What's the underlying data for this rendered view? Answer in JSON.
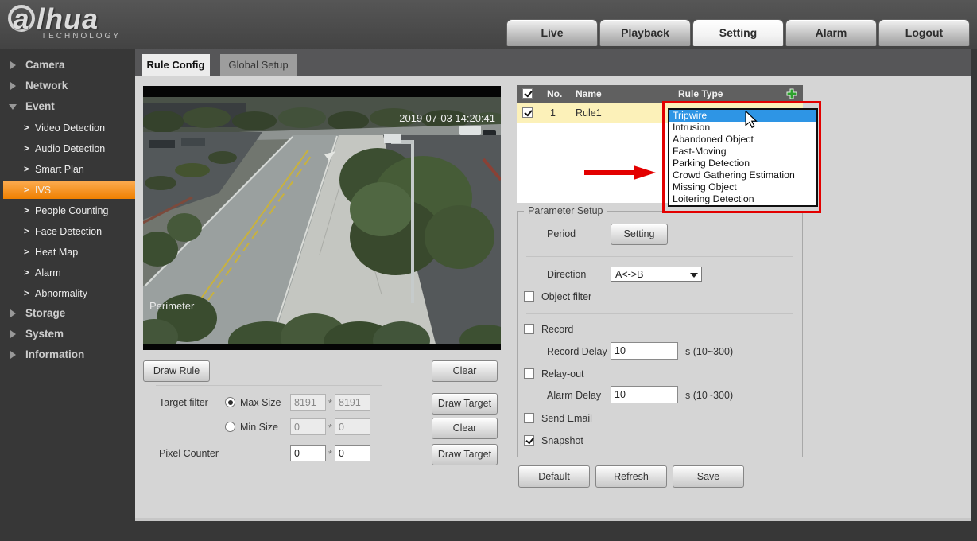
{
  "header": {
    "logo_text": "a",
    "logo_text_rest": "lhua",
    "logo_subtext": "TECHNOLOGY",
    "nav": [
      {
        "label": "Live"
      },
      {
        "label": "Playback"
      },
      {
        "label": "Setting"
      },
      {
        "label": "Alarm"
      },
      {
        "label": "Logout"
      }
    ],
    "active_nav": "Setting"
  },
  "sidebar": {
    "chevron_glyph": ">",
    "items": [
      {
        "label": "Camera"
      },
      {
        "label": "Network"
      },
      {
        "label": "Event"
      },
      {
        "label": "Storage"
      },
      {
        "label": "System"
      },
      {
        "label": "Information"
      }
    ],
    "event_children": [
      {
        "label": "Video Detection"
      },
      {
        "label": "Audio Detection"
      },
      {
        "label": "Smart Plan"
      },
      {
        "label": "IVS"
      },
      {
        "label": "People Counting"
      },
      {
        "label": "Face Detection"
      },
      {
        "label": "Heat Map"
      },
      {
        "label": "Alarm"
      },
      {
        "label": "Abnormality"
      }
    ],
    "active_item": "IVS"
  },
  "tabs": {
    "rule_config": "Rule Config",
    "global_setup": "Global Setup",
    "active": "Rule Config"
  },
  "video": {
    "timestamp": "2019-07-03 14:20:41",
    "channel_label": "Perimeter"
  },
  "rule_table": {
    "col_no": "No.",
    "col_name": "Name",
    "col_rule_type": "Rule Type",
    "row": {
      "no": "1",
      "name": "Rule1",
      "checked": true
    }
  },
  "rule_type_dropdown": {
    "selected": "Tripwire",
    "options": [
      {
        "label": "Tripwire"
      },
      {
        "label": "Intrusion"
      },
      {
        "label": "Abandoned Object"
      },
      {
        "label": "Fast-Moving"
      },
      {
        "label": "Parking Detection"
      },
      {
        "label": "Crowd Gathering Estimation"
      },
      {
        "label": "Missing Object"
      },
      {
        "label": "Loitering Detection"
      }
    ]
  },
  "draw_panel": {
    "draw_rule": "Draw Rule",
    "clear_rule": "Clear",
    "target_filter": "Target filter",
    "max_size": "Max Size",
    "max_w": "8191",
    "max_h": "8191",
    "min_size": "Min Size",
    "min_w": "0",
    "min_h": "0",
    "pixel_counter": "Pixel Counter",
    "pixel_w": "0",
    "pixel_h": "0",
    "draw_target": "Draw Target",
    "clear_target": "Clear",
    "draw_target2": "Draw Target",
    "times": "*"
  },
  "parameter_setup": {
    "title": "Parameter Setup",
    "period_label": "Period",
    "period_button": "Setting",
    "direction_label": "Direction",
    "direction_value": "A<->B",
    "object_filter_label": "Object filter",
    "record_label": "Record",
    "record_delay_label": "Record Delay",
    "record_delay_value": "10",
    "record_delay_unit": "s (10~300)",
    "relay_out_label": "Relay-out",
    "alarm_delay_label": "Alarm Delay",
    "alarm_delay_value": "10",
    "alarm_delay_unit": "s (10~300)",
    "send_email_label": "Send Email",
    "snapshot_label": "Snapshot"
  },
  "actions": {
    "default": "Default",
    "refresh": "Refresh",
    "save": "Save"
  },
  "colors": {
    "sidebar_active_orange": "#ef8000",
    "selection_blue": "#2e95e5",
    "annotation_red": "#e30000",
    "row_highlight_yellow": "#fcf1b9",
    "table_header_gray": "#606060"
  }
}
